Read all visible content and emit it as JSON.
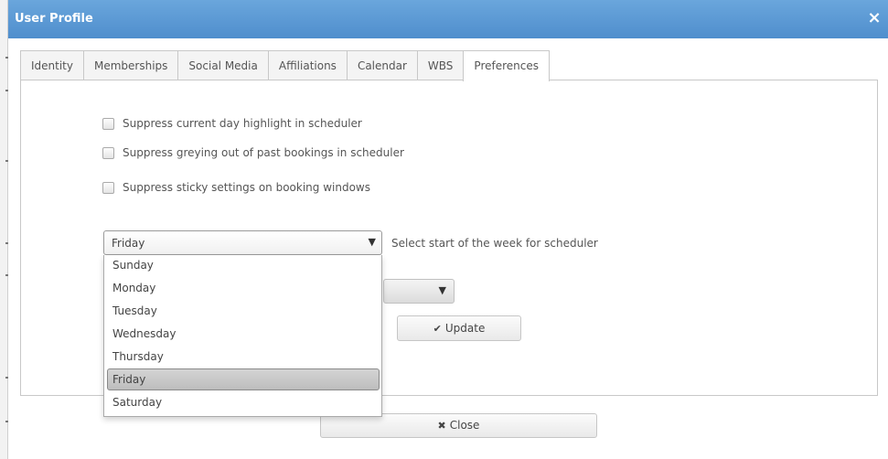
{
  "dialog": {
    "title": "User Profile",
    "close_icon": "×"
  },
  "tabs": [
    {
      "label": "Identity"
    },
    {
      "label": "Memberships"
    },
    {
      "label": "Social Media"
    },
    {
      "label": "Affiliations"
    },
    {
      "label": "Calendar"
    },
    {
      "label": "WBS"
    },
    {
      "label": "Preferences",
      "active": true
    }
  ],
  "preferences": {
    "checkboxes": [
      {
        "label": "Suppress current day highlight in scheduler",
        "checked": false
      },
      {
        "label": "Suppress greying out of past bookings in scheduler",
        "checked": false
      },
      {
        "label": "Suppress sticky settings on booking windows",
        "checked": false
      }
    ],
    "week_start": {
      "selected": "Friday",
      "arrow": "▼",
      "description": "Select start of the week for scheduler",
      "options": [
        "Sunday",
        "Monday",
        "Tuesday",
        "Wednesday",
        "Thursday",
        "Friday",
        "Saturday"
      ]
    },
    "second_select_arrow": "▼",
    "update_button": {
      "icon": "✔",
      "label": "Update"
    }
  },
  "footer": {
    "close_button": {
      "icon": "✖",
      "label": "Close"
    }
  },
  "colors": {
    "titlebar": "#5b9bd5",
    "selected_option": "#c8c8c8"
  }
}
